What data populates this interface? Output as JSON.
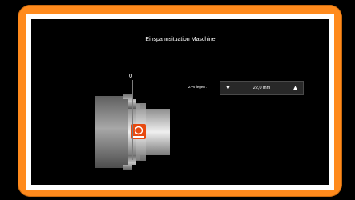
{
  "title": "Einspannsituation Maschine",
  "axis_zero_label": "0",
  "z_offset": {
    "label": "Z-Anlegen :",
    "value": "22,0 mm",
    "down_icon": "triangle-down-icon",
    "up_icon": "triangle-up-icon"
  },
  "badge_icon": "machine-logo-icon",
  "colors": {
    "frame": "#ff8a1c",
    "screen": "#000000",
    "chuck": "#8c8c8c",
    "workpiece": "#d6d6d6",
    "badge": "#e84a10"
  }
}
